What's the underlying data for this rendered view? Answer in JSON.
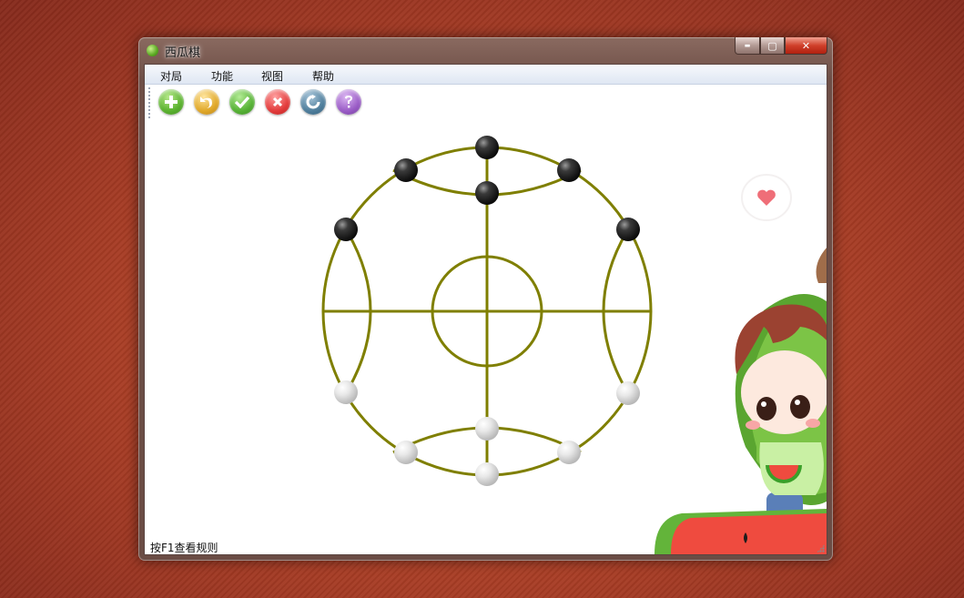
{
  "window": {
    "title": "西瓜棋",
    "controls": {
      "minimize": "▬",
      "maximize": "▢",
      "close": "✕"
    }
  },
  "menubar": {
    "items": [
      {
        "label": "对局"
      },
      {
        "label": "功能"
      },
      {
        "label": "视图"
      },
      {
        "label": "帮助"
      }
    ]
  },
  "toolbar": {
    "buttons": [
      {
        "icon": "plus-icon",
        "color": "#5bb230"
      },
      {
        "icon": "undo-icon",
        "color": "#e0a829"
      },
      {
        "icon": "check-icon",
        "color": "#57b236"
      },
      {
        "icon": "x-icon",
        "color": "#e23b3b"
      },
      {
        "icon": "refresh-icon",
        "color": "#4f7e9c"
      },
      {
        "icon": "question-icon",
        "color": "#9a5cc6"
      }
    ]
  },
  "board": {
    "line_color": "#7f7f00",
    "black_pieces": 6,
    "white_pieces": 6
  },
  "statusbar": {
    "text": "按F1查看规则"
  },
  "colors": {
    "background": "#b0432a",
    "black_piece": "#1f1f1f",
    "white_piece": "#e6e6e6"
  }
}
